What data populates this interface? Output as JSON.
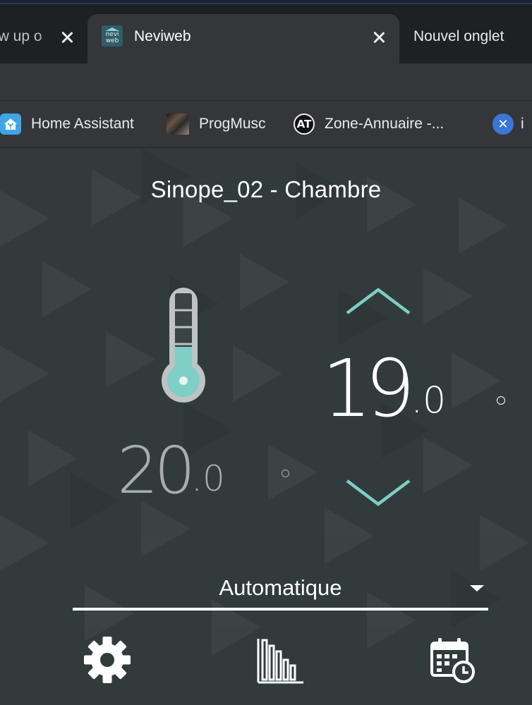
{
  "browser": {
    "tabs": [
      {
        "label": "ow up o",
        "close_icon": "close-icon"
      },
      {
        "label": "Neviweb",
        "favicon": "neviweb-icon",
        "favicon_text": [
          "nevi",
          "web"
        ],
        "active": true,
        "close_icon": "close-icon"
      },
      {
        "label": "Nouvel onglet"
      }
    ],
    "bookmarks": [
      {
        "label": "Home Assistant",
        "icon": "home-assistant-icon"
      },
      {
        "label": "ProgMusc",
        "icon": "progmusc-icon"
      },
      {
        "label": "Zone-Annuaire -...",
        "icon": "zone-annuaire-icon",
        "icon_text": "AT"
      },
      {
        "label": "i",
        "icon": "x-circle-icon"
      }
    ]
  },
  "thermostat": {
    "title": "Sinope_02 - Chambre",
    "current_temp": {
      "integer": "20",
      "decimal": ".0"
    },
    "setpoint": {
      "integer": "19",
      "decimal": ".0"
    },
    "thermometer_level": 0.3,
    "mode": "Automatique",
    "icons": {
      "increase": "chevron-up-icon",
      "decrease": "chevron-down-icon",
      "thermometer": "thermometer-icon",
      "settings": "gear-icon",
      "statistics": "bar-chart-icon",
      "schedule": "calendar-clock-icon"
    }
  },
  "colors": {
    "background": "#323b3b",
    "accent": "#7ecfc6",
    "current_temp": "#a8adad",
    "text": "#ffffff"
  }
}
